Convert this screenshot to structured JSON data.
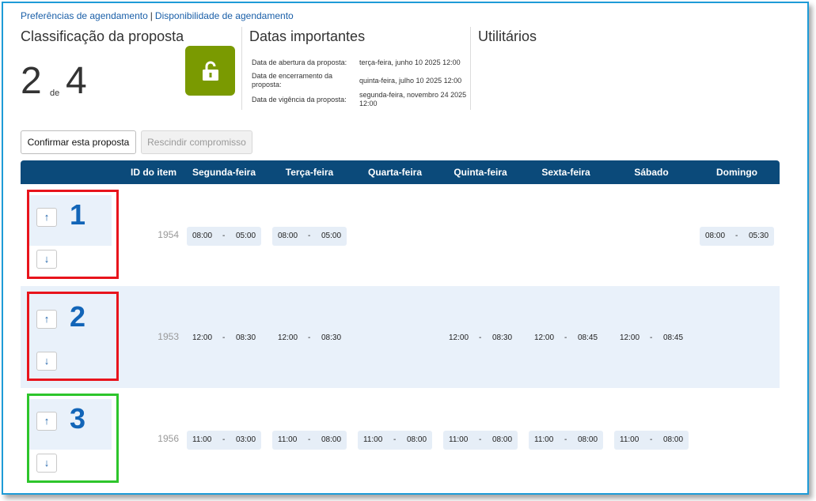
{
  "links": {
    "preferences": "Preferências de agendamento",
    "separator": "|",
    "availability": "Disponibilidade de agendamento"
  },
  "ranking": {
    "title": "Classificação da proposta",
    "current": "2",
    "of_label": "de",
    "total": "4"
  },
  "important_dates": {
    "title": "Datas importantes",
    "rows": [
      {
        "label": "Data de abertura da proposta:",
        "value": "terça-feira, junho 10 2025 12:00"
      },
      {
        "label": "Data de encerramento da proposta:",
        "value": "quinta-feira, julho 10 2025 12:00"
      },
      {
        "label": "Data de vigência da proposta:",
        "value": "segunda-feira, novembro 24 2025 12:00"
      }
    ]
  },
  "utilities": {
    "title": "Utilitários"
  },
  "buttons": {
    "confirm": "Confirmar esta proposta",
    "rescind": "Rescindir compromisso"
  },
  "grid": {
    "headers": [
      "ID do item",
      "Segunda-feira",
      "Terça-feira",
      "Quarta-feira",
      "Quinta-feira",
      "Sexta-feira",
      "Sábado",
      "Domingo"
    ],
    "rows": [
      {
        "rank": "1",
        "item_id": "1954",
        "highlight": "red",
        "slots": [
          {
            "start": "08:00",
            "dash": "-",
            "end": "05:00"
          },
          {
            "start": "08:00",
            "dash": "-",
            "end": "05:00"
          },
          null,
          null,
          null,
          null,
          {
            "start": "08:00",
            "dash": "-",
            "end": "05:30"
          }
        ]
      },
      {
        "rank": "2",
        "item_id": "1953",
        "highlight": "red",
        "slots": [
          {
            "start": "12:00",
            "dash": "-",
            "end": "08:30"
          },
          {
            "start": "12:00",
            "dash": "-",
            "end": "08:30"
          },
          null,
          {
            "start": "12:00",
            "dash": "-",
            "end": "08:30"
          },
          {
            "start": "12:00",
            "dash": "-",
            "end": "08:45"
          },
          {
            "start": "12:00",
            "dash": "-",
            "end": "08:45"
          },
          null
        ]
      },
      {
        "rank": "3",
        "item_id": "1956",
        "highlight": "green",
        "slots": [
          {
            "start": "11:00",
            "dash": "-",
            "end": "03:00"
          },
          {
            "start": "11:00",
            "dash": "-",
            "end": "08:00"
          },
          {
            "start": "11:00",
            "dash": "-",
            "end": "08:00"
          },
          {
            "start": "11:00",
            "dash": "-",
            "end": "08:00"
          },
          {
            "start": "11:00",
            "dash": "-",
            "end": "08:00"
          },
          {
            "start": "11:00",
            "dash": "-",
            "end": "08:00"
          },
          null
        ]
      }
    ]
  },
  "icons": {
    "lock": "unlock-icon",
    "up": "arrow-up-icon",
    "down": "arrow-down-icon",
    "up_glyph": "↑",
    "down_glyph": "↓"
  },
  "colors": {
    "header_bg": "#0b4a7a",
    "lock_bg": "#7a9a01",
    "rank_color": "#1265b8",
    "highlight_red": "#e8141c",
    "highlight_green": "#2dc52b"
  }
}
